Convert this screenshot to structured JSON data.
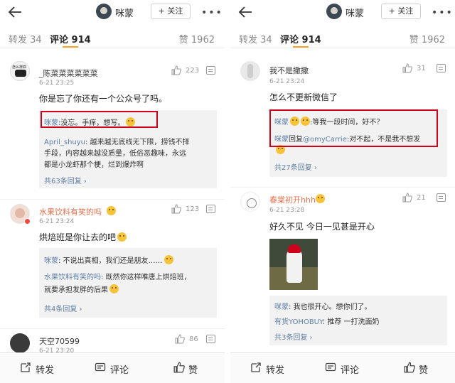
{
  "left": {
    "top_bar": {
      "name": "咪蒙",
      "follow_label": "+ 关注",
      "more_label": "•••"
    },
    "tabs": {
      "repost": "转发 34",
      "comment": "评论 914",
      "like": "赞 1962"
    },
    "comments": [
      {
        "avatar_text": "怎么样四",
        "name": "_陈菜菜菜菜菜菜",
        "time": "6-21 23:25",
        "likes": "223",
        "text": "你是忘了你还有一个公众号了吗。",
        "replies": [
          {
            "name": "咪蒙",
            "text": ":没忘。手痒，想写。"
          },
          {
            "name": "April_shuyu",
            "text": ": 越来越无底线无下限，捞钱不择"
          },
          {
            "name": "",
            "text": "手段，内容越来越没质量，低俗恶趣味，永远"
          },
          {
            "name": "",
            "text": "都是小龙虾那个梗，烂到爆炸啊"
          }
        ],
        "more": "共63条回复 ›"
      },
      {
        "name": "水果饮料有笑的吗",
        "time": "6-21 23:24",
        "likes": "123",
        "text": "烘焙班是你让去的吧",
        "replies": [
          {
            "name": "咪蒙",
            "text": ": 不说出真相，我们还是朋友……"
          },
          {
            "name": "水果饮料有笑的吗",
            "text": ": 既然你这样唯唐上烘焙班，"
          },
          {
            "name": "",
            "text": "就要承担发胖的后果"
          }
        ],
        "more": "共4条回复 ›"
      },
      {
        "name": "天空70599",
        "time": "6-21 23:20",
        "likes": "86"
      }
    ],
    "bottom_bar": {
      "repost": "转发",
      "comment": "评论",
      "like": "赞"
    }
  },
  "right": {
    "top_bar": {
      "name": "咪蒙",
      "follow_label": "+ 关注",
      "more_label": "•••"
    },
    "tabs": {
      "repost": "转发 34",
      "comment": "评论 914",
      "like": "赞 1962"
    },
    "comments": [
      {
        "name": "我不是撒撒",
        "time": "6-21 23:24",
        "likes": "31",
        "text": "怎么不更新微信了",
        "replies": [
          {
            "name": "咪蒙",
            "text": ":等我一段时间，好不？"
          },
          {
            "name": "咪蒙",
            "reply_word": "回复",
            "at": "@omyCarrie",
            "text": ":对不起，不是我不想发"
          }
        ],
        "more": "共27条回复 ›"
      },
      {
        "name": "春棠初开hhh",
        "time": "6-21 23:28",
        "likes": "21",
        "text": "好久不见 今日一见甚是开心",
        "replies": [
          {
            "name": "咪蒙",
            "text": ": 我也很开心。想你们了。"
          },
          {
            "name": "有货YOHOBUY",
            "text": ": 推荐 一打洗面奶"
          }
        ],
        "more": "共3条回复 ›"
      }
    ],
    "bottom_bar": {
      "repost": "转发",
      "comment": "评论",
      "like": "赞"
    }
  },
  "colors": {
    "accent": "#f5a623",
    "link": "#5d7fa6",
    "highlight": "#d0021b",
    "name_orange": "#eb7350"
  },
  "icons": [
    "back-arrow-icon",
    "ellipsis-icon",
    "thumbs-up-icon",
    "reply-icon",
    "repost-icon",
    "comment-icon",
    "emoji-icon"
  ]
}
